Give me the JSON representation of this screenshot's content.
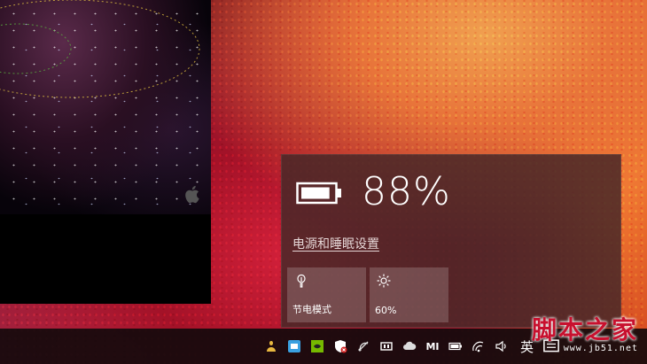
{
  "flyout": {
    "battery_percent": "88%",
    "battery_level": 0.88,
    "power_settings_link": "电源和睡眠设置",
    "tiles": [
      {
        "label": "节电模式",
        "icon": "battery-saver-icon"
      },
      {
        "label": "60%",
        "icon": "brightness-icon"
      }
    ]
  },
  "taskbar": {
    "tray_icons": [
      "person-icon",
      "app-icon",
      "nvidia-icon",
      "security-icon",
      "network-warning-icon",
      "window-icon",
      "cloud-icon",
      "mi-icon",
      "battery-icon",
      "wifi-icon",
      "volume-icon"
    ],
    "ime_label": "英",
    "mi_label": "MI"
  },
  "watermark": {
    "title": "脚本之家",
    "url": "www.jb51.net"
  },
  "colors": {
    "flyout_bg": "#482828",
    "watermark_red": "#c8102e"
  }
}
